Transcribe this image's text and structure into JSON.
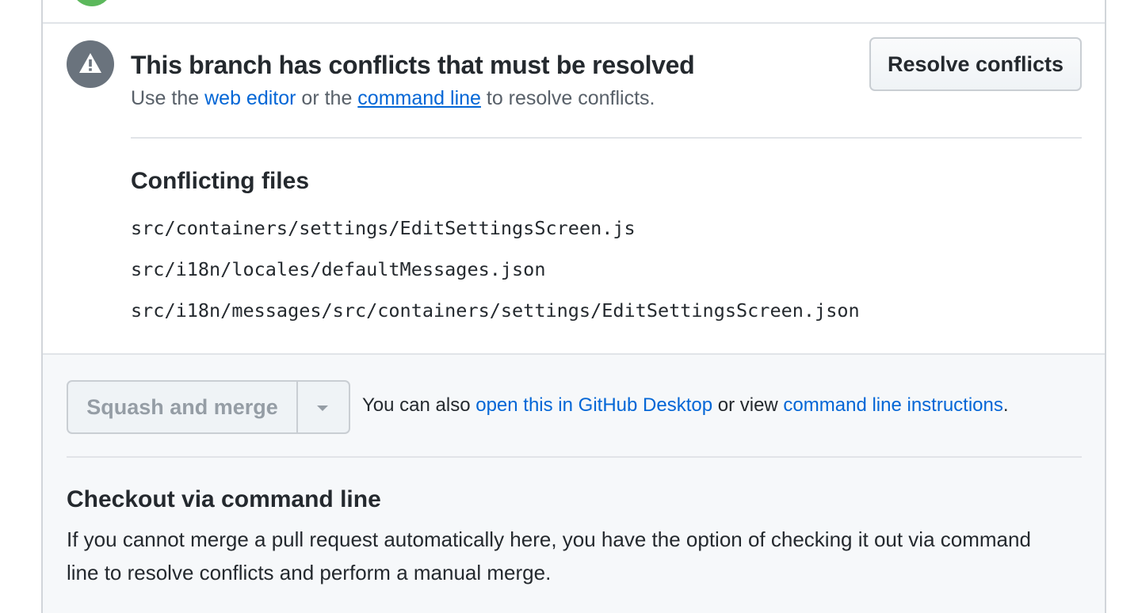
{
  "conflict": {
    "title": "This branch has conflicts that must be resolved",
    "sub_prefix": "Use the ",
    "web_editor_link": "web editor",
    "sub_mid": " or the ",
    "command_line_link": "command line",
    "sub_suffix": " to resolve conflicts.",
    "resolve_button": "Resolve conflicts"
  },
  "conflicting_files": {
    "title": "Conflicting files",
    "files": [
      "src/containers/settings/EditSettingsScreen.js",
      "src/i18n/locales/defaultMessages.json",
      "src/i18n/messages/src/containers/settings/EditSettingsScreen.json"
    ]
  },
  "merge": {
    "button_label": "Squash and merge",
    "also_prefix": "You can also ",
    "desktop_link": "open this in GitHub Desktop",
    "also_mid": " or view ",
    "instructions_link": "command line instructions",
    "also_suffix": "."
  },
  "checkout": {
    "title": "Checkout via command line",
    "description": "If you cannot merge a pull request automatically here, you have the option of checking it out via command line to resolve conflicts and perform a manual merge."
  },
  "colors": {
    "link": "#0366d6",
    "status_green": "#5cb85c",
    "warning_icon_bg": "#6a737d"
  },
  "icons": {
    "status": "check-status-icon",
    "warning": "alert-icon",
    "dropdown": "caret-down-icon"
  }
}
